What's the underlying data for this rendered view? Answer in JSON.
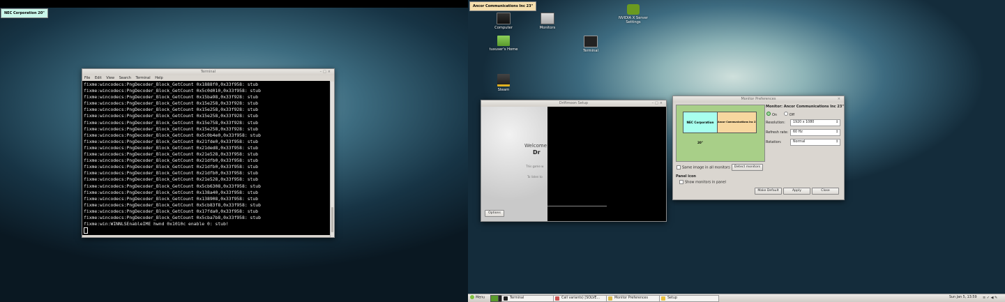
{
  "left_screen": {
    "label": "NEC Corporation 20\""
  },
  "right_screen": {
    "label": "Ancor Communications Inc 23\""
  },
  "terminal": {
    "title": "Terminal",
    "menu": [
      "File",
      "Edit",
      "View",
      "Search",
      "Terminal",
      "Help"
    ],
    "lines": [
      "fixme:wincodecs:PngDecoder_Block_GetCount 0x1888f0,0x33f958: stub",
      "fixme:wincodecs:PngDecoder_Block_GetCount 0x5c0d010,0x33f958: stub",
      "fixme:wincodecs:PngDecoder_Block_GetCount 0x15ba98,0x33f928: stub",
      "fixme:wincodecs:PngDecoder_Block_GetCount 0x15e258,0x33f928: stub",
      "fixme:wincodecs:PngDecoder_Block_GetCount 0x15e258,0x33f928: stub",
      "fixme:wincodecs:PngDecoder_Block_GetCount 0x15e258,0x33f928: stub",
      "fixme:wincodecs:PngDecoder_Block_GetCount 0x15e758,0x33f928: stub",
      "fixme:wincodecs:PngDecoder_Block_GetCount 0x15e258,0x33f928: stub",
      "fixme:wincodecs:PngDecoder_Block_GetCount 0x5c0b4e0,0x33f958: stub",
      "fixme:wincodecs:PngDecoder_Block_GetCount 0x21fde0,0x33f958: stub",
      "fixme:wincodecs:PngDecoder_Block_GetCount 0x21ded8,0x33f958: stub",
      "fixme:wincodecs:PngDecoder_Block_GetCount 0x21e528,0x33f958: stub",
      "fixme:wincodecs:PngDecoder_Block_GetCount 0x21dfb0,0x33f958: stub",
      "fixme:wincodecs:PngDecoder_Block_GetCount 0x21dfb0,0x33f958: stub",
      "fixme:wincodecs:PngDecoder_Block_GetCount 0x21dfb0,0x33f958: stub",
      "fixme:wincodecs:PngDecoder_Block_GetCount 0x21e528,0x33f958: stub",
      "fixme:wincodecs:PngDecoder_Block_GetCount 0x5cb6308,0x33f958: stub",
      "fixme:wincodecs:PngDecoder_Block_GetCount 0x138a40,0x33f958: stub",
      "fixme:wincodecs:PngDecoder_Block_GetCount 0x138908,0x33f958: stub",
      "fixme:wincodecs:PngDecoder_Block_GetCount 0x5cb83f8,0x33f958: stub",
      "fixme:wincodecs:PngDecoder_Block_GetCount 0x17fda0,0x33f958: stub",
      "fixme:wincodecs:PngDecoder_Block_GetCount 0x5cba7b8,0x33f958: stub",
      "fixme:win:WINNLSEnableIME hwnd 0x1010c enable 0: stub!"
    ]
  },
  "desktop_icons": [
    {
      "label": "Computer",
      "icon": "computer-icon"
    },
    {
      "label": "Monitors",
      "icon": "monitors-icon"
    },
    {
      "label": "NVIDIA X Server Settings",
      "icon": "nvidia-icon"
    },
    {
      "label": "tuxuser's Home",
      "icon": "home-folder-icon"
    },
    {
      "label": "Terminal",
      "icon": "terminal-icon"
    },
    {
      "label": "Steam",
      "icon": "steam-icon"
    }
  ],
  "driftmoon": {
    "title": "Driftmoon Setup",
    "welcome": "Welcome",
    "brand_fragment": "Dr",
    "line1": "This game w",
    "line2": "To listen to",
    "options_button": "Options"
  },
  "monitor_prefs": {
    "title": "Monitor Preferences",
    "monitor_a": "NEC Corporation 20\"",
    "monitor_b": "Ancor Communications Inc 23\"",
    "heading": "Monitor: Ancor Communications Inc 23\"",
    "on_label": "On",
    "off_label": "Off",
    "resolution_label": "Resolution:",
    "resolution_value": "1920 x 1080",
    "refresh_label": "Refresh rate:",
    "refresh_value": "60 Hz",
    "rotation_label": "Rotation:",
    "rotation_value": "Normal",
    "same_image_label": "Same image in all monitors",
    "detect_button": "Detect monitors",
    "panel_icon_heading": "Panel icon",
    "show_monitors_label": "Show monitors in panel",
    "make_default_button": "Make Default",
    "apply_button": "Apply",
    "close_button": "Close"
  },
  "taskbar": {
    "menu_label": "Menu",
    "tasks": [
      {
        "label": "Terminal",
        "icon": "terminal-task-icon"
      },
      {
        "label": "Call variants) [SOLVE...",
        "icon": "browser-task-icon"
      },
      {
        "label": "Monitor Preferences",
        "icon": "monitor-prefs-task-icon"
      },
      {
        "label": "Setup",
        "icon": "setup-task-icon"
      }
    ],
    "clock": "Sun Jan  5, 13:59"
  },
  "colors": {
    "nec_label_bg": "#c9f7ea",
    "ancor_label_bg": "#f5dfae",
    "monitor_canvas_bg": "#a8cf88",
    "nec_box": "#a8ffee",
    "ancor_box": "#f7d79f"
  }
}
